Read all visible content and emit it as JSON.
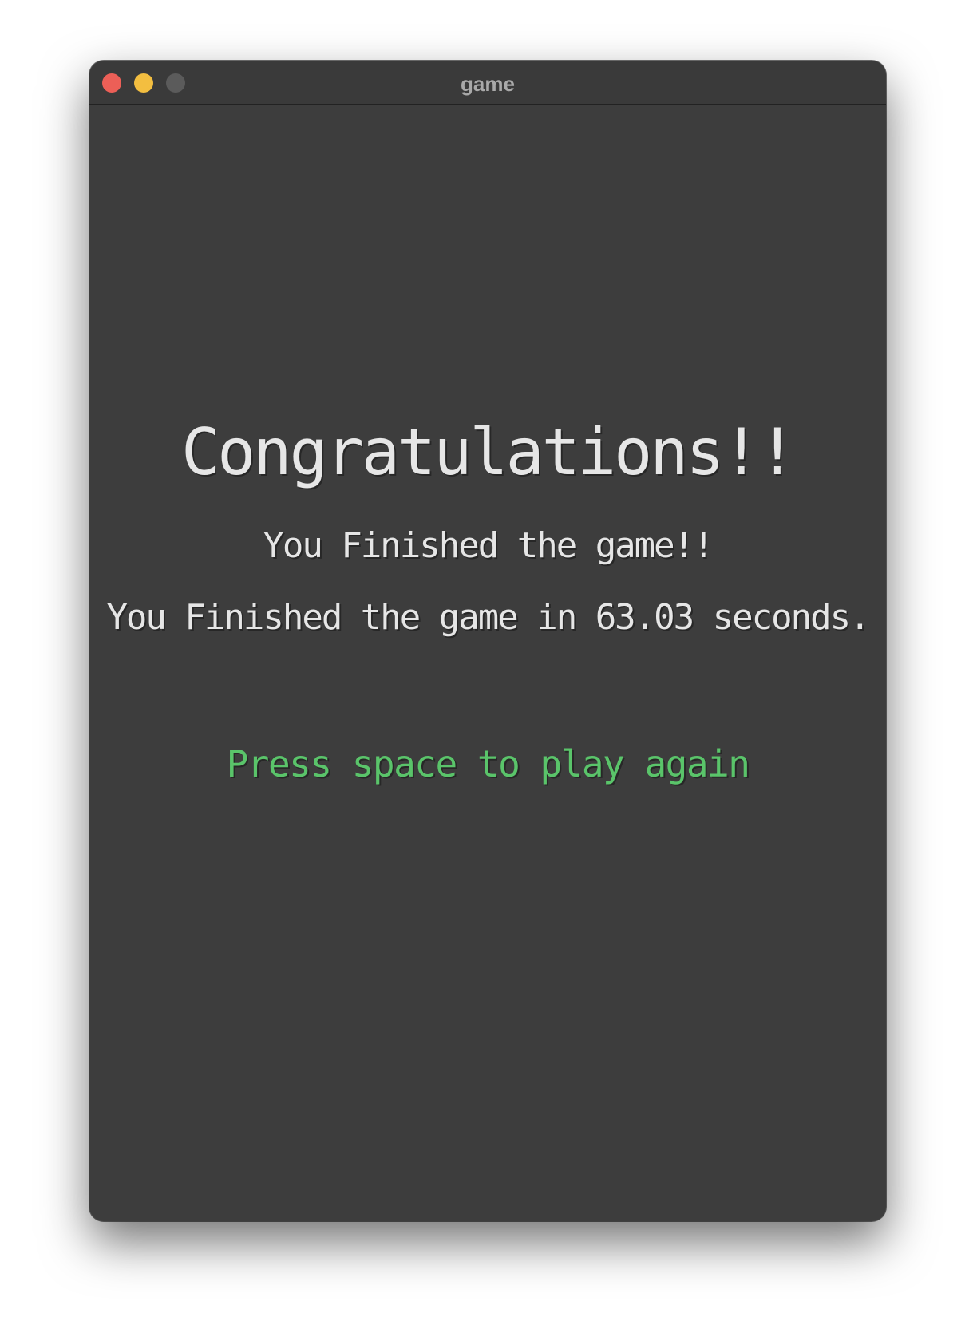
{
  "window": {
    "title": "game"
  },
  "screen": {
    "headline": "Congratulations!!",
    "finished_message": "You Finished the game!!",
    "time_message": "You Finished the game in 63.03 seconds.",
    "prompt": "Press space to play again"
  },
  "colors": {
    "background": "#3d3d3d",
    "text": "#e6e6e6",
    "prompt": "#5ac46a",
    "close_button": "#ec5f57",
    "minimize_button": "#f3be40",
    "zoom_button": "#5b5b5b"
  }
}
